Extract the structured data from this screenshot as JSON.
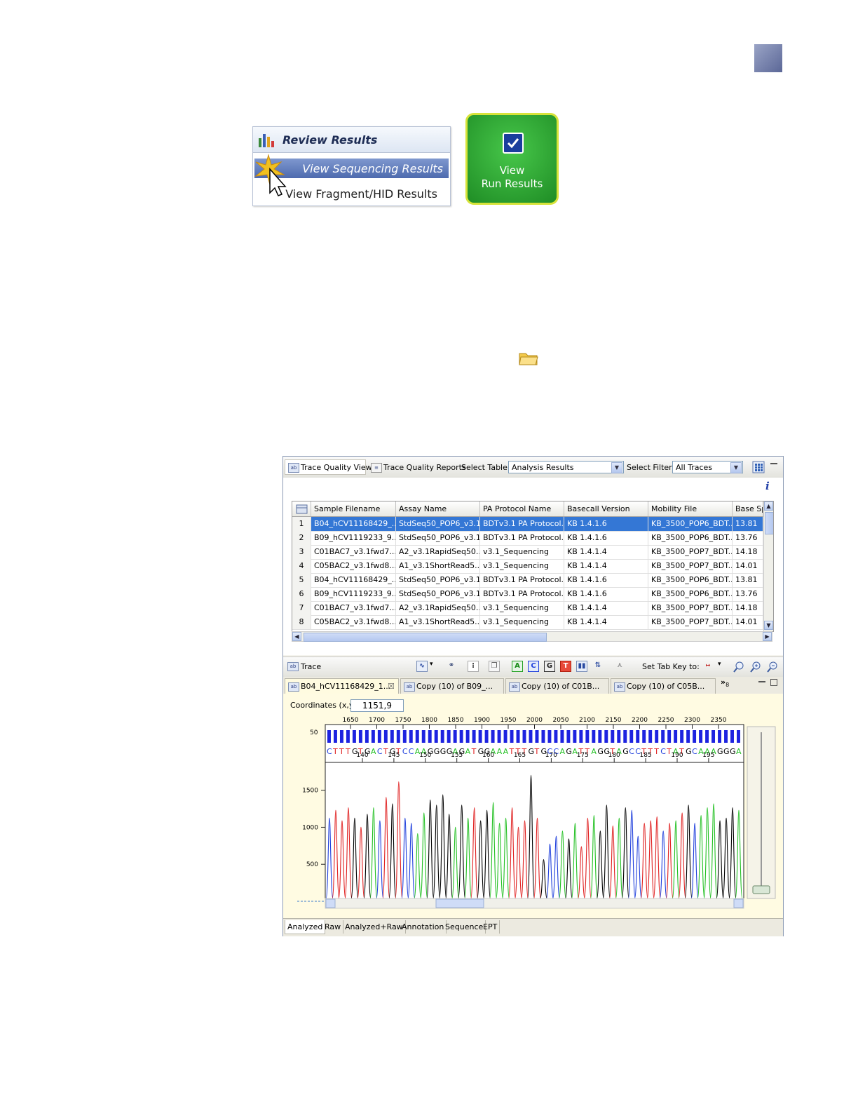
{
  "review_results": {
    "title": "Review Results",
    "items": [
      "View Sequencing Results",
      "View Fragment/HID Results"
    ]
  },
  "run_button": {
    "line1": "View",
    "line2": "Run Results"
  },
  "toolbar": {
    "tab_quality_view": "Trace Quality View",
    "tab_quality_reports": "Trace Quality Reports",
    "select_table_label": "Select Table:",
    "select_table_value": "Analysis Results",
    "select_filter_label": "Select Filter:",
    "select_filter_value": "All Traces"
  },
  "table": {
    "headers": [
      "Sample Filename",
      "Assay Name",
      "PA Protocol Name",
      "Basecall Version",
      "Mobility File",
      "Base Sp"
    ],
    "rows": [
      [
        "1",
        "B04_hCV11168429_...",
        "StdSeq50_POP6_v3.1",
        "BDTv3.1 PA Protocol...",
        "KB 1.4.1.6",
        "KB_3500_POP6_BDT...",
        "13.81"
      ],
      [
        "2",
        "B09_hCV1119233_9...",
        "StdSeq50_POP6_v3.1",
        "BDTv3.1 PA Protocol...",
        "KB 1.4.1.6",
        "KB_3500_POP6_BDT...",
        "13.76"
      ],
      [
        "3",
        "C01BAC7_v3.1fwd7...",
        "A2_v3.1RapidSeq50...",
        "v3.1_Sequencing",
        "KB 1.4.1.4",
        "KB_3500_POP7_BDT...",
        "14.18"
      ],
      [
        "4",
        "C05BAC2_v3.1fwd8...",
        "A1_v3.1ShortRead5...",
        "v3.1_Sequencing",
        "KB 1.4.1.4",
        "KB_3500_POP7_BDT...",
        "14.01"
      ],
      [
        "5",
        "B04_hCV11168429_...",
        "StdSeq50_POP6_v3.1",
        "BDTv3.1 PA Protocol...",
        "KB 1.4.1.6",
        "KB_3500_POP6_BDT...",
        "13.81"
      ],
      [
        "6",
        "B09_hCV1119233_9...",
        "StdSeq50_POP6_v3.1",
        "BDTv3.1 PA Protocol...",
        "KB 1.4.1.6",
        "KB_3500_POP6_BDT...",
        "13.76"
      ],
      [
        "7",
        "C01BAC7_v3.1fwd7...",
        "A2_v3.1RapidSeq50...",
        "v3.1_Sequencing",
        "KB 1.4.1.4",
        "KB_3500_POP7_BDT...",
        "14.18"
      ],
      [
        "8",
        "C05BAC2_v3.1fwd8...",
        "A1_v3.1ShortRead5...",
        "v3.1_Sequencing",
        "KB 1.4.1.4",
        "KB_3500_POP7_BDT...",
        "14.01"
      ]
    ]
  },
  "trace_toolbar": {
    "title": "Trace",
    "set_tab_key_label": "Set Tab Key to:",
    "base_buttons": [
      "A",
      "C",
      "G",
      "T"
    ]
  },
  "doc_tabs": [
    "B04_hCV11168429_1...",
    "Copy (10) of B09_...",
    "Copy (10) of C01B...",
    "Copy (10) of C05B..."
  ],
  "doc_tabs_overflow": "8",
  "coordinates": {
    "label": "Coordinates (x,y):",
    "value": "1151,9"
  },
  "plot": {
    "scan_ticks": [
      "1650",
      "1700",
      "1750",
      "1800",
      "1850",
      "1900",
      "1950",
      "2000",
      "2050",
      "2100",
      "2150",
      "2200",
      "2250",
      "2300",
      "2350"
    ],
    "qv_tick": "50",
    "sequence": "CTTTGTGACTGTCCAAGGGGAGATGGAAATTTGTGCCAGATTAGGTAGCCTTTCTATGCAAAGGGA",
    "base_ticks": [
      "140",
      "145",
      "150",
      "155",
      "160",
      "165",
      "170",
      "175",
      "180",
      "185",
      "190",
      "195"
    ],
    "y_ticks": [
      "1500",
      "1000",
      "500"
    ]
  },
  "bottom_tabs": [
    "Analyzed",
    "Raw",
    "Analyzed+Raw",
    "Annotation",
    "Sequence",
    "EPT"
  ],
  "colors": {
    "A": "#22c022",
    "C": "#1f3fdc",
    "G": "#000000",
    "T": "#e02020",
    "selection": "#3477d5"
  }
}
